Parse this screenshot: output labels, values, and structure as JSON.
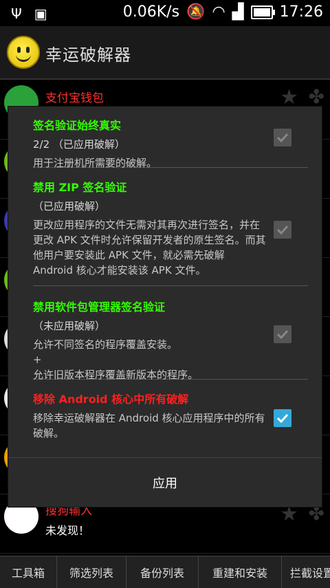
{
  "status_bar": {
    "net_speed": "0.06K/s",
    "time": "17:26",
    "icons": [
      "usb-icon",
      "image-icon",
      "mute-icon",
      "wifi-icon",
      "signal-icon",
      "battery-icon"
    ]
  },
  "app": {
    "title": "幸运破解器",
    "logo_icon": "smiley-icon"
  },
  "background_list": {
    "items": [
      {
        "name": "支付宝钱包",
        "sub": "",
        "icon_color": "#2aa13a"
      },
      {
        "name": "",
        "sub": "",
        "icon_color": "#6cba1a"
      },
      {
        "name": "",
        "sub": "",
        "icon_color": "#3a3ab0"
      },
      {
        "name": "",
        "sub": "",
        "icon_color": "#6cba1a"
      },
      {
        "name": "",
        "sub": "",
        "icon_color": "#dddddd"
      },
      {
        "name": "",
        "sub": "",
        "icon_color": "#e9e9e9"
      },
      {
        "name": "",
        "sub": "",
        "icon_color": "#f0a000"
      },
      {
        "name": "",
        "sub": "",
        "icon_color": "#e01090"
      },
      {
        "name": "搜狗输入",
        "sub": "未发现！",
        "icon_color": "#ffffff"
      }
    ]
  },
  "dialog": {
    "options": [
      {
        "title": "签名验证始终真实",
        "status": "2/2 （已应用破解）",
        "description": "用于注册机所需要的破解。",
        "checked": false,
        "title_color": "#33ff00"
      },
      {
        "title": "禁用 ZIP 签名验证",
        "status": "（已应用破解）",
        "description": "更改应用程序的文件无需对其再次进行签名，并在更改 APK 文件时允许保留开发者的原生签名。而其他用户要安装此 APK 文件，就必需先破解 Android 核心才能安装该 APK 文件。",
        "checked": false,
        "title_color": "#33ff00"
      },
      {
        "title": "禁用软件包管理器签名验证",
        "status": "（未应用破解）",
        "description_lines": [
          "允许不同签名的程序覆盖安装。",
          "+",
          "允许旧版本程序覆盖新版本的程序。"
        ],
        "checked": false,
        "title_color": "#33ff00"
      },
      {
        "title": "移除 Android 核心中所有破解",
        "status": "",
        "description": "移除幸运破解器在 Android 核心应用程序中的所有破解。",
        "checked": true,
        "title_color": "#ff2020"
      }
    ],
    "apply_label": "应用"
  },
  "tabs": [
    "工具箱",
    "筛选列表",
    "备份列表",
    "重建和安装",
    "拦截设置"
  ],
  "colors": {
    "accent_check": "#34a9d8",
    "green_title": "#33ff00",
    "red_title": "#ff2020"
  }
}
